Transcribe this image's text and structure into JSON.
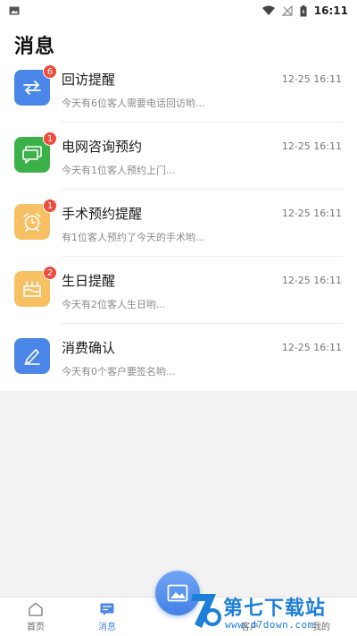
{
  "status_bar": {
    "time": "16:11",
    "icons": [
      "image-notification-icon",
      "wifi-icon",
      "no-signal-icon",
      "battery-icon"
    ]
  },
  "header": {
    "title": "消息"
  },
  "messages": [
    {
      "title": "回访提醒",
      "subtitle": "今天有6位客人需要电话回访哟...",
      "time": "12-25 16:11",
      "badge": "6",
      "icon": "swap-arrows-icon",
      "color": "#4a86e8"
    },
    {
      "title": "电网咨询预约",
      "subtitle": "今天有1位客人预约上门...",
      "time": "12-25 16:11",
      "badge": "1",
      "icon": "chat-bubbles-icon",
      "color": "#3cb14a"
    },
    {
      "title": "手术预约提醒",
      "subtitle": "有1位客人预约了今天的手术哟...",
      "time": "12-25 16:11",
      "badge": "1",
      "icon": "alarm-clock-icon",
      "color": "#f7c063"
    },
    {
      "title": "生日提醒",
      "subtitle": "今天有2位客人生日哟...",
      "time": "12-25 16:11",
      "badge": "2",
      "icon": "birthday-cake-icon",
      "color": "#f7c063"
    },
    {
      "title": "消费确认",
      "subtitle": "今天有0个客户要签名哟...",
      "time": "12-25 16:11",
      "badge": "",
      "icon": "pen-sign-icon",
      "color": "#4a86e8"
    }
  ],
  "bottom_nav": {
    "tabs": [
      {
        "label": "首页",
        "icon": "home-icon",
        "active": false
      },
      {
        "label": "消息",
        "icon": "message-icon",
        "active": true
      },
      {
        "label": "客户",
        "icon": "customer-icon",
        "active": false
      },
      {
        "label": "我的",
        "icon": "profile-icon",
        "active": false
      }
    ],
    "fab_icon": "image-icon"
  },
  "watermark": {
    "text": "第七下载站",
    "url": "www.d7down.com"
  },
  "colors": {
    "accent": "#4a86e8",
    "badge": "#f04a3d",
    "green": "#3cb14a",
    "yellow": "#f7c063"
  }
}
